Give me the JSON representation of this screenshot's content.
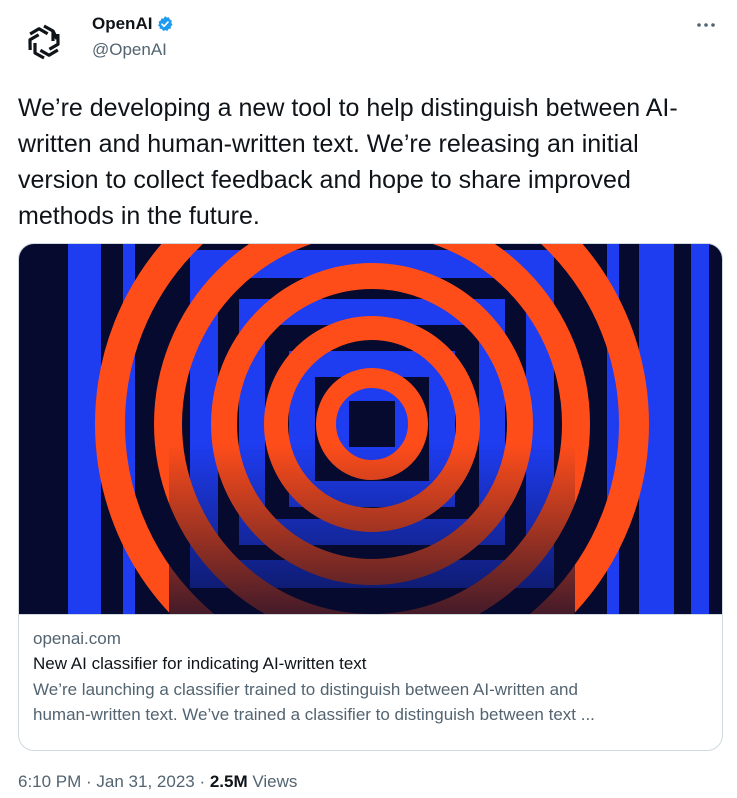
{
  "author": {
    "name": "OpenAI",
    "handle": "@OpenAI",
    "verified_color": "#1d9bf0"
  },
  "icons": {
    "avatar": "openai-logo-icon",
    "verified": "verified-badge-icon",
    "more": "more-options-icon"
  },
  "tweet": {
    "text": "We’re developing a new tool to help distinguish between AI-written and human-written text. We’re releasing an initial version to collect feedback and hope to share improved methods in the future."
  },
  "card": {
    "domain": "openai.com",
    "title": "New AI classifier for indicating AI-written text",
    "description": "We’re launching a classifier trained to distinguish between AI-written and\nhuman-written text. We’ve trained a classifier to distinguish between text ...",
    "colors": {
      "background": "#060a2e",
      "blue": "#1e3cf0",
      "orange": "#ff4d1a"
    }
  },
  "footer": {
    "time": "6:10 PM",
    "sep1": " · ",
    "date": "Jan 31, 2023",
    "sep2": " · ",
    "views_count": "2.5M",
    "views_label": " Views"
  }
}
